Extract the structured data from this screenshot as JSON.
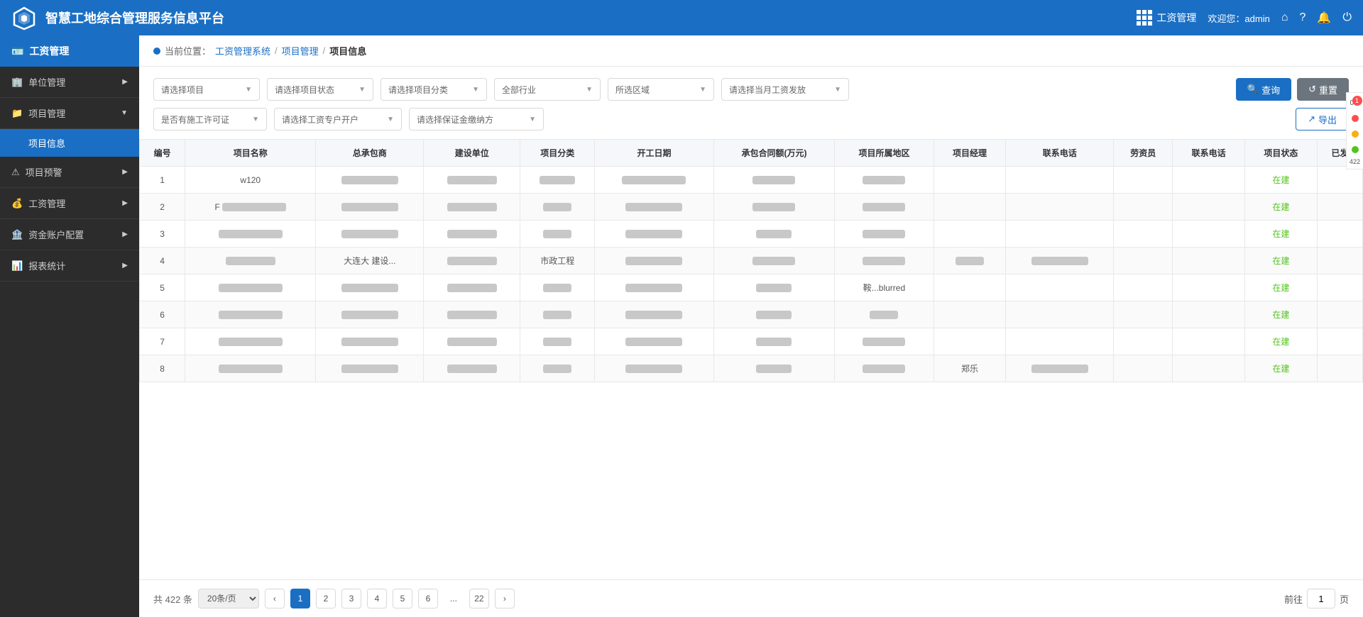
{
  "header": {
    "logo_alt": "智慧工地logo",
    "title": "智慧工地综合管理服务信息平台",
    "module_icon": "grid-icon",
    "module_label": "工资管理",
    "welcome": "欢迎您：admin",
    "icons": [
      "home-icon",
      "question-icon",
      "bell-icon",
      "power-icon"
    ]
  },
  "sidebar": {
    "header_icon": "id-card-icon",
    "header_label": "工资管理",
    "items": [
      {
        "id": "unit-mgmt",
        "label": "单位管理",
        "icon": "building-icon",
        "expandable": true,
        "expanded": false
      },
      {
        "id": "project-mgmt",
        "label": "项目管理",
        "icon": "folder-icon",
        "expandable": true,
        "expanded": true
      },
      {
        "id": "project-info",
        "label": "项目信息",
        "sub": true,
        "active": true
      },
      {
        "id": "project-warning",
        "label": "项目预警",
        "icon": "warning-icon",
        "expandable": true,
        "expanded": false
      },
      {
        "id": "salary-mgmt",
        "label": "工资管理",
        "icon": "money-icon",
        "expandable": true,
        "expanded": false
      },
      {
        "id": "fund-account",
        "label": "资金账户配置",
        "icon": "bank-icon",
        "expandable": true,
        "expanded": false
      },
      {
        "id": "report-stats",
        "label": "报表统计",
        "icon": "chart-icon",
        "expandable": true,
        "expanded": false
      }
    ]
  },
  "breadcrumb": {
    "items": [
      "工资管理系统",
      "项目管理",
      "项目信息"
    ]
  },
  "filters": {
    "row1": [
      {
        "id": "project-select",
        "placeholder": "请选择项目"
      },
      {
        "id": "status-select",
        "placeholder": "请选择项目状态"
      },
      {
        "id": "category-select",
        "placeholder": "请选择项目分类"
      },
      {
        "id": "industry-select",
        "placeholder": "全部行业"
      },
      {
        "id": "region-select",
        "placeholder": "所选区域"
      },
      {
        "id": "salary-month-select",
        "placeholder": "请选择当月工资发放"
      }
    ],
    "row2": [
      {
        "id": "license-select",
        "placeholder": "是否有施工许可证"
      },
      {
        "id": "special-account-select",
        "placeholder": "请选择工资专户开户"
      },
      {
        "id": "deposit-select",
        "placeholder": "请选择保证金缴纳方"
      }
    ],
    "query_btn": "查询",
    "reset_btn": "重置",
    "export_btn": "导出"
  },
  "table": {
    "columns": [
      "编号",
      "项目名称",
      "总承包商",
      "建设单位",
      "项目分类",
      "开工日期",
      "承包合同额(万元)",
      "项目所属地区",
      "项目经理",
      "联系电话",
      "劳资员",
      "联系电话",
      "项目状态",
      "已发"
    ],
    "rows": [
      {
        "id": 1,
        "name": "w120",
        "contractor": "blurred-80",
        "owner": "blurred-70",
        "category": "blurred-50",
        "start_date": "blurred-90",
        "contract_amount": "blurred-60",
        "region": "blurred-60",
        "manager": "",
        "phone": "",
        "labor": "",
        "labor_phone": "",
        "status": "在建",
        "issued": ""
      },
      {
        "id": 2,
        "name": "F blurred-90",
        "contractor": "blurred-80",
        "owner": "blurred-70",
        "category": "blurred-40",
        "start_date": "blurred-80",
        "contract_amount": "blurred-60",
        "region": "blurred-60",
        "manager": "",
        "phone": "",
        "labor": "",
        "labor_phone": "",
        "status": "在建",
        "issued": ""
      },
      {
        "id": 3,
        "name": "blurred-90",
        "contractor": "blurred-80",
        "owner": "blurred-70",
        "category": "blurred-40",
        "start_date": "blurred-80",
        "contract_amount": "blurred-50",
        "region": "blurred-60",
        "manager": "",
        "phone": "",
        "labor": "",
        "labor_phone": "",
        "status": "在建",
        "issued": ""
      },
      {
        "id": 4,
        "name": "blurred-70",
        "contractor": "大连大 建设...",
        "owner": "blurred-70",
        "category": "市政工程",
        "start_date": "blurred-80",
        "contract_amount": "blurred-60",
        "region": "blurred-60",
        "manager": "blurred-40",
        "phone": "blurred-80",
        "labor": "",
        "labor_phone": "",
        "status": "在建",
        "issued": ""
      },
      {
        "id": 5,
        "name": "blurred-90",
        "contractor": "blurred-80",
        "owner": "blurred-70",
        "category": "blurred-40",
        "start_date": "blurred-80",
        "contract_amount": "blurred-50",
        "region": "鞍...blurred",
        "manager": "",
        "phone": "",
        "labor": "",
        "labor_phone": "",
        "status": "在建",
        "issued": ""
      },
      {
        "id": 6,
        "name": "blurred-90",
        "contractor": "blurred-80",
        "owner": "blurred-70",
        "category": "blurred-40",
        "start_date": "blurred-80",
        "contract_amount": "blurred-50",
        "region": "blurred-40",
        "manager": "",
        "phone": "",
        "labor": "",
        "labor_phone": "",
        "status": "在建",
        "issued": ""
      },
      {
        "id": 7,
        "name": "blurred-90",
        "contractor": "blurred-80",
        "owner": "blurred-70",
        "category": "blurred-40",
        "start_date": "blurred-80",
        "contract_amount": "blurred-50",
        "region": "blurred-60",
        "manager": "",
        "phone": "",
        "labor": "",
        "labor_phone": "",
        "status": "在建",
        "issued": ""
      },
      {
        "id": 8,
        "name": "blurred-90",
        "contractor": "blurred-80",
        "owner": "blurred-70",
        "category": "blurred-40",
        "start_date": "blurred-80",
        "contract_amount": "blurred-50",
        "region": "blurred-60",
        "manager": "郑乐",
        "phone": "blurred-80",
        "labor": "",
        "labor_phone": "",
        "status": "在建",
        "issued": ""
      }
    ]
  },
  "pagination": {
    "total_text": "共 422 条",
    "page_size": "20条/页",
    "pages": [
      1,
      2,
      3,
      4,
      5,
      6,
      "...",
      22
    ],
    "current_page": 1,
    "prev_btn": "‹",
    "next_btn": "›",
    "goto_prefix": "前往",
    "goto_value": "1",
    "goto_suffix": "页"
  },
  "right_panel": {
    "badge_count": "1",
    "dots": [
      "#ff4d4f",
      "#faad14",
      "#52c41a"
    ]
  },
  "colors": {
    "primary": "#1a6fc4",
    "sidebar_bg": "#2c2c2c",
    "header_bg": "#1a6fc4",
    "active_sidebar": "#1a6fc4",
    "status_active": "#52c41a"
  }
}
